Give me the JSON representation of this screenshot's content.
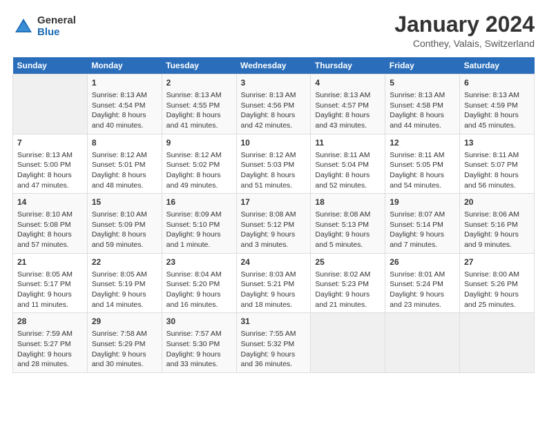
{
  "logo": {
    "general": "General",
    "blue": "Blue"
  },
  "title": "January 2024",
  "location": "Conthey, Valais, Switzerland",
  "days_of_week": [
    "Sunday",
    "Monday",
    "Tuesday",
    "Wednesday",
    "Thursday",
    "Friday",
    "Saturday"
  ],
  "weeks": [
    [
      {
        "day": "",
        "sunrise": "",
        "sunset": "",
        "daylight": ""
      },
      {
        "day": "1",
        "sunrise": "Sunrise: 8:13 AM",
        "sunset": "Sunset: 4:54 PM",
        "daylight": "Daylight: 8 hours and 40 minutes."
      },
      {
        "day": "2",
        "sunrise": "Sunrise: 8:13 AM",
        "sunset": "Sunset: 4:55 PM",
        "daylight": "Daylight: 8 hours and 41 minutes."
      },
      {
        "day": "3",
        "sunrise": "Sunrise: 8:13 AM",
        "sunset": "Sunset: 4:56 PM",
        "daylight": "Daylight: 8 hours and 42 minutes."
      },
      {
        "day": "4",
        "sunrise": "Sunrise: 8:13 AM",
        "sunset": "Sunset: 4:57 PM",
        "daylight": "Daylight: 8 hours and 43 minutes."
      },
      {
        "day": "5",
        "sunrise": "Sunrise: 8:13 AM",
        "sunset": "Sunset: 4:58 PM",
        "daylight": "Daylight: 8 hours and 44 minutes."
      },
      {
        "day": "6",
        "sunrise": "Sunrise: 8:13 AM",
        "sunset": "Sunset: 4:59 PM",
        "daylight": "Daylight: 8 hours and 45 minutes."
      }
    ],
    [
      {
        "day": "7",
        "sunrise": "Sunrise: 8:13 AM",
        "sunset": "Sunset: 5:00 PM",
        "daylight": "Daylight: 8 hours and 47 minutes."
      },
      {
        "day": "8",
        "sunrise": "Sunrise: 8:12 AM",
        "sunset": "Sunset: 5:01 PM",
        "daylight": "Daylight: 8 hours and 48 minutes."
      },
      {
        "day": "9",
        "sunrise": "Sunrise: 8:12 AM",
        "sunset": "Sunset: 5:02 PM",
        "daylight": "Daylight: 8 hours and 49 minutes."
      },
      {
        "day": "10",
        "sunrise": "Sunrise: 8:12 AM",
        "sunset": "Sunset: 5:03 PM",
        "daylight": "Daylight: 8 hours and 51 minutes."
      },
      {
        "day": "11",
        "sunrise": "Sunrise: 8:11 AM",
        "sunset": "Sunset: 5:04 PM",
        "daylight": "Daylight: 8 hours and 52 minutes."
      },
      {
        "day": "12",
        "sunrise": "Sunrise: 8:11 AM",
        "sunset": "Sunset: 5:05 PM",
        "daylight": "Daylight: 8 hours and 54 minutes."
      },
      {
        "day": "13",
        "sunrise": "Sunrise: 8:11 AM",
        "sunset": "Sunset: 5:07 PM",
        "daylight": "Daylight: 8 hours and 56 minutes."
      }
    ],
    [
      {
        "day": "14",
        "sunrise": "Sunrise: 8:10 AM",
        "sunset": "Sunset: 5:08 PM",
        "daylight": "Daylight: 8 hours and 57 minutes."
      },
      {
        "day": "15",
        "sunrise": "Sunrise: 8:10 AM",
        "sunset": "Sunset: 5:09 PM",
        "daylight": "Daylight: 8 hours and 59 minutes."
      },
      {
        "day": "16",
        "sunrise": "Sunrise: 8:09 AM",
        "sunset": "Sunset: 5:10 PM",
        "daylight": "Daylight: 9 hours and 1 minute."
      },
      {
        "day": "17",
        "sunrise": "Sunrise: 8:08 AM",
        "sunset": "Sunset: 5:12 PM",
        "daylight": "Daylight: 9 hours and 3 minutes."
      },
      {
        "day": "18",
        "sunrise": "Sunrise: 8:08 AM",
        "sunset": "Sunset: 5:13 PM",
        "daylight": "Daylight: 9 hours and 5 minutes."
      },
      {
        "day": "19",
        "sunrise": "Sunrise: 8:07 AM",
        "sunset": "Sunset: 5:14 PM",
        "daylight": "Daylight: 9 hours and 7 minutes."
      },
      {
        "day": "20",
        "sunrise": "Sunrise: 8:06 AM",
        "sunset": "Sunset: 5:16 PM",
        "daylight": "Daylight: 9 hours and 9 minutes."
      }
    ],
    [
      {
        "day": "21",
        "sunrise": "Sunrise: 8:05 AM",
        "sunset": "Sunset: 5:17 PM",
        "daylight": "Daylight: 9 hours and 11 minutes."
      },
      {
        "day": "22",
        "sunrise": "Sunrise: 8:05 AM",
        "sunset": "Sunset: 5:19 PM",
        "daylight": "Daylight: 9 hours and 14 minutes."
      },
      {
        "day": "23",
        "sunrise": "Sunrise: 8:04 AM",
        "sunset": "Sunset: 5:20 PM",
        "daylight": "Daylight: 9 hours and 16 minutes."
      },
      {
        "day": "24",
        "sunrise": "Sunrise: 8:03 AM",
        "sunset": "Sunset: 5:21 PM",
        "daylight": "Daylight: 9 hours and 18 minutes."
      },
      {
        "day": "25",
        "sunrise": "Sunrise: 8:02 AM",
        "sunset": "Sunset: 5:23 PM",
        "daylight": "Daylight: 9 hours and 21 minutes."
      },
      {
        "day": "26",
        "sunrise": "Sunrise: 8:01 AM",
        "sunset": "Sunset: 5:24 PM",
        "daylight": "Daylight: 9 hours and 23 minutes."
      },
      {
        "day": "27",
        "sunrise": "Sunrise: 8:00 AM",
        "sunset": "Sunset: 5:26 PM",
        "daylight": "Daylight: 9 hours and 25 minutes."
      }
    ],
    [
      {
        "day": "28",
        "sunrise": "Sunrise: 7:59 AM",
        "sunset": "Sunset: 5:27 PM",
        "daylight": "Daylight: 9 hours and 28 minutes."
      },
      {
        "day": "29",
        "sunrise": "Sunrise: 7:58 AM",
        "sunset": "Sunset: 5:29 PM",
        "daylight": "Daylight: 9 hours and 30 minutes."
      },
      {
        "day": "30",
        "sunrise": "Sunrise: 7:57 AM",
        "sunset": "Sunset: 5:30 PM",
        "daylight": "Daylight: 9 hours and 33 minutes."
      },
      {
        "day": "31",
        "sunrise": "Sunrise: 7:55 AM",
        "sunset": "Sunset: 5:32 PM",
        "daylight": "Daylight: 9 hours and 36 minutes."
      },
      {
        "day": "",
        "sunrise": "",
        "sunset": "",
        "daylight": ""
      },
      {
        "day": "",
        "sunrise": "",
        "sunset": "",
        "daylight": ""
      },
      {
        "day": "",
        "sunrise": "",
        "sunset": "",
        "daylight": ""
      }
    ]
  ]
}
